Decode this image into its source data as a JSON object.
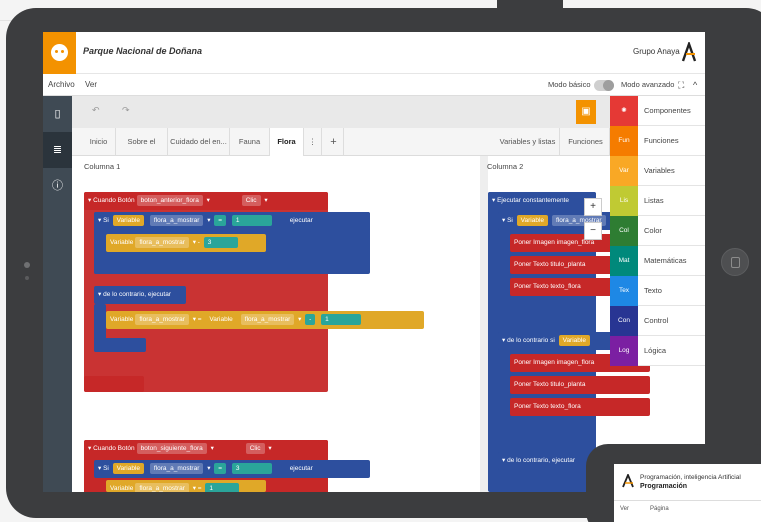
{
  "app": {
    "title": "Parque Nacional de Doñana",
    "brand": "Grupo Anaya"
  },
  "menu": {
    "archivo": "Archivo",
    "ver": "Ver",
    "basic": "Modo básico",
    "advanced": "Modo avanzado"
  },
  "tabs": [
    "Inicio",
    "Sobre el parque",
    "Cuidado del en...",
    "Fauna",
    "Flora"
  ],
  "tabs_right": [
    "Variables y listas",
    "Funciones"
  ],
  "workspace": {
    "col1": "Columna 1",
    "col2": "Columna 2"
  },
  "blocks": {
    "when1": "Cuando  Botón",
    "btn1": "boton_anterior_flora",
    "click": "Clic",
    "si": "Si",
    "variable": "Variable",
    "var": "flora_a_mostrar",
    "eq": "=",
    "one": "1",
    "three": "3",
    "ejecutar": "ejecutar",
    "else": "de lo contrario, ejecutar",
    "minus": "-",
    "when2": "Cuando  Botón",
    "btn2": "boton_siguiente_flora",
    "forever": "Ejecutar constantemente",
    "img_flora": "Poner  Imagen   imagen_flora",
    "txt_title": "Poner  Texto   titulo_planta",
    "txt_text": "Poner  Texto   texto_flora",
    "elseif": "de lo contrario si"
  },
  "categories": [
    {
      "chip": "",
      "label": "Componentes",
      "color": "#e53935"
    },
    {
      "chip": "Fun",
      "label": "Funciones",
      "color": "#f57c00"
    },
    {
      "chip": "Var",
      "label": "Variables",
      "color": "#f9a825"
    },
    {
      "chip": "Lis",
      "label": "Listas",
      "color": "#c0ca33"
    },
    {
      "chip": "Col",
      "label": "Color",
      "color": "#2e7d32"
    },
    {
      "chip": "Mat",
      "label": "Matemáticas",
      "color": "#00897b"
    },
    {
      "chip": "Tex",
      "label": "Texto",
      "color": "#1e88e5"
    },
    {
      "chip": "Con",
      "label": "Control",
      "color": "#283593"
    },
    {
      "chip": "Log",
      "label": "Lógica",
      "color": "#7b1fa2"
    }
  ],
  "overlay": {
    "title": "Programación, inteligencia Artificial",
    "subtitle": "Programación",
    "menu1": "Ver",
    "menu2": "Página"
  }
}
